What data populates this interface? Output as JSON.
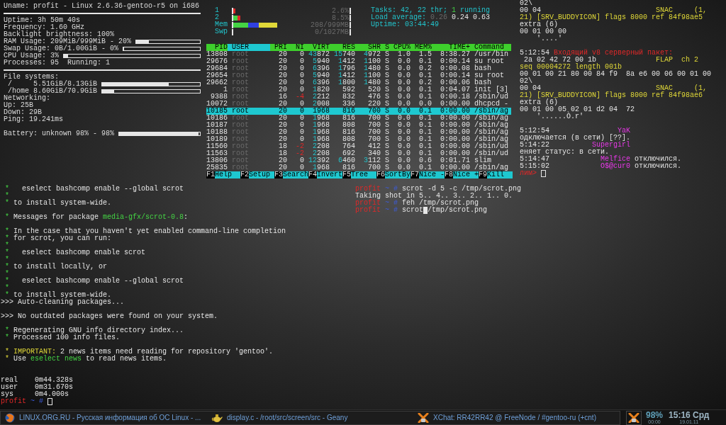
{
  "conky": {
    "items": [
      {
        "kind": "text",
        "text": "Uname: profit - Linux 2.6.36-gentoo-r5 on i686"
      },
      {
        "kind": "rule"
      },
      {
        "kind": "text",
        "text": "Uptime: 3h 50m 40s"
      },
      {
        "kind": "text",
        "text": "Frequency: 1.60 GHz"
      },
      {
        "kind": "text",
        "text": "Backlight brightness: 100%"
      },
      {
        "kind": "bar",
        "text": "RAM Usage: 209MiB/999MiB - 20%",
        "level": 0.2
      },
      {
        "kind": "bar",
        "text": "Swap Usage: 0B/1.00GiB - 0%",
        "level": 0
      },
      {
        "kind": "bar",
        "text": "CPU Usage: 3%",
        "level": 0.03
      },
      {
        "kind": "text",
        "text": "Processes: 95  Running: 1"
      },
      {
        "kind": "rule"
      },
      {
        "kind": "text",
        "text": "File systems:"
      },
      {
        "kind": "bar",
        "text": " /     5.51GiB/8.13GiB",
        "level": 0.68
      },
      {
        "kind": "bar",
        "text": " /home 8.60GiB/70.9GiB",
        "level": 0.12
      },
      {
        "kind": "text",
        "text": "Networking:"
      },
      {
        "kind": "text",
        "text": "Up: 25B"
      },
      {
        "kind": "text",
        "text": "Down: 29B"
      },
      {
        "kind": "text",
        "text": "Ping: 19.241ms"
      },
      {
        "kind": "blank"
      },
      {
        "kind": "bar",
        "text": "Battery: unknown 98% - 98%",
        "level": 0.98
      }
    ]
  },
  "htop": {
    "meters": [
      {
        "label": "1",
        "segments": [
          {
            "kind": "kernel",
            "level": 0.03
          }
        ],
        "value": "2.6%"
      },
      {
        "label": "2",
        "segments": [
          {
            "kind": "user",
            "level": 0.06
          },
          {
            "kind": "kernel",
            "level": 0.09
          }
        ],
        "value": "8.5%"
      },
      {
        "label": "Mem",
        "segments": [
          {
            "kind": "used",
            "level": 0.19
          },
          {
            "kind": "buffers",
            "level": 0.33
          },
          {
            "kind": "cache",
            "level": 0.57
          }
        ],
        "value": "208/999MB"
      },
      {
        "label": "Swp",
        "value": "0/1027MB"
      }
    ],
    "info_lines": [
      [
        {
          "text": "Tasks: 42, 22 thr; ",
          "kind": "label"
        },
        {
          "text": "1",
          "kind": "good"
        },
        {
          "text": " running",
          "kind": "label"
        }
      ],
      [
        {
          "text": "Load average: ",
          "kind": "label"
        },
        {
          "text": "0.26 ",
          "kind": "dim"
        },
        {
          "text": "0.24 0.63",
          "kind": "plain"
        }
      ],
      [
        {
          "text": "Uptime: 03:44:49",
          "kind": "label"
        }
      ]
    ],
    "columns": [
      {
        "label": "PID",
        "selected": false
      },
      {
        "label": "USER",
        "selected": true
      },
      {
        "label": "PRI",
        "selected": false
      },
      {
        "label": "NI",
        "selected": false
      },
      {
        "label": "VIRT",
        "selected": false
      },
      {
        "label": "RES",
        "selected": false
      },
      {
        "label": "SHR",
        "selected": false
      },
      {
        "label": "S",
        "selected": false
      },
      {
        "label": "CPU%",
        "selected": false
      },
      {
        "label": "MEM%",
        "selected": false
      },
      {
        "label": "TIME+",
        "selected": false
      },
      {
        "label": "Command",
        "selected": false
      }
    ],
    "rows": [
      {
        "pid": "13808",
        "user": "root",
        "pri": "20",
        "ni": "0",
        "virt": "43872",
        "res": "15740",
        "shr": "4972",
        "state": "S",
        "cpu": "1.0",
        "mem": "1.5",
        "time": "8:38.27",
        "command": "/usr/bin",
        "selected": false
      },
      {
        "pid": "29676",
        "user": "root",
        "pri": "20",
        "ni": "0",
        "virt": "5940",
        "res": "1412",
        "shr": "1100",
        "state": "S",
        "cpu": "0.0",
        "mem": "0.1",
        "time": "0:00.14",
        "command": "su root",
        "selected": false
      },
      {
        "pid": "29684",
        "user": "root",
        "pri": "20",
        "ni": "0",
        "virt": "6396",
        "res": "1796",
        "shr": "1480",
        "state": "S",
        "cpu": "0.0",
        "mem": "0.2",
        "time": "0:00.08",
        "command": "bash",
        "selected": false
      },
      {
        "pid": "29654",
        "user": "root",
        "pri": "20",
        "ni": "0",
        "virt": "5940",
        "res": "1412",
        "shr": "1100",
        "state": "S",
        "cpu": "0.0",
        "mem": "0.1",
        "time": "0:00.14",
        "command": "su root",
        "selected": false
      },
      {
        "pid": "29662",
        "user": "root",
        "pri": "20",
        "ni": "0",
        "virt": "6396",
        "res": "1800",
        "shr": "1480",
        "state": "S",
        "cpu": "0.0",
        "mem": "0.2",
        "time": "0:00.06",
        "command": "bash",
        "selected": false
      },
      {
        "pid": "1",
        "user": "root",
        "pri": "20",
        "ni": "0",
        "virt": "1820",
        "res": "592",
        "shr": "520",
        "state": "S",
        "cpu": "0.0",
        "mem": "0.1",
        "time": "0:04.07",
        "command": "init [3]",
        "selected": false
      },
      {
        "pid": "9388",
        "user": "root",
        "pri": "16",
        "ni": "-4",
        "virt": "2212",
        "res": "832",
        "shr": "476",
        "state": "S",
        "cpu": "0.0",
        "mem": "0.1",
        "time": "0:00.18",
        "command": "/sbin/ud",
        "selected": false
      },
      {
        "pid": "10072",
        "user": "root",
        "pri": "20",
        "ni": "0",
        "virt": "2008",
        "res": "336",
        "shr": "220",
        "state": "S",
        "cpu": "0.0",
        "mem": "0.0",
        "time": "0:00.00",
        "command": "dhcpcd -",
        "selected": false
      },
      {
        "pid": "10185",
        "user": "root",
        "pri": "20",
        "ni": "0",
        "virt": "1968",
        "res": "816",
        "shr": "700",
        "state": "S",
        "cpu": "0.0",
        "mem": "0.1",
        "time": "0:00.00",
        "command": "/sbin/ag",
        "selected": true
      },
      {
        "pid": "10186",
        "user": "root",
        "pri": "20",
        "ni": "0",
        "virt": "1968",
        "res": "816",
        "shr": "700",
        "state": "S",
        "cpu": "0.0",
        "mem": "0.1",
        "time": "0:00.00",
        "command": "/sbin/ag",
        "selected": false
      },
      {
        "pid": "10187",
        "user": "root",
        "pri": "20",
        "ni": "0",
        "virt": "1968",
        "res": "808",
        "shr": "700",
        "state": "S",
        "cpu": "0.0",
        "mem": "0.1",
        "time": "0:00.00",
        "command": "/sbin/ag",
        "selected": false
      },
      {
        "pid": "10188",
        "user": "root",
        "pri": "20",
        "ni": "0",
        "virt": "1968",
        "res": "816",
        "shr": "700",
        "state": "S",
        "cpu": "0.0",
        "mem": "0.1",
        "time": "0:00.00",
        "command": "/sbin/ag",
        "selected": false
      },
      {
        "pid": "10189",
        "user": "root",
        "pri": "20",
        "ni": "0",
        "virt": "1968",
        "res": "808",
        "shr": "700",
        "state": "S",
        "cpu": "0.0",
        "mem": "0.1",
        "time": "0:00.00",
        "command": "/sbin/ag",
        "selected": false
      },
      {
        "pid": "11560",
        "user": "root",
        "pri": "18",
        "ni": "-2",
        "virt": "2208",
        "res": "764",
        "shr": "412",
        "state": "S",
        "cpu": "0.0",
        "mem": "0.1",
        "time": "0:00.00",
        "command": "/sbin/ud",
        "selected": false
      },
      {
        "pid": "11563",
        "user": "root",
        "pri": "18",
        "ni": "-2",
        "virt": "2208",
        "res": "692",
        "shr": "340",
        "state": "S",
        "cpu": "0.0",
        "mem": "0.1",
        "time": "0:00.00",
        "command": "/sbin/ud",
        "selected": false
      },
      {
        "pid": "13806",
        "user": "root",
        "pri": "20",
        "ni": "0",
        "virt": "12392",
        "res": "6460",
        "shr": "3112",
        "state": "S",
        "cpu": "0.0",
        "mem": "0.6",
        "time": "0:01.71",
        "command": "slim",
        "selected": false
      },
      {
        "pid": "25835",
        "user": "root",
        "pri": "20",
        "ni": "0",
        "virt": "1968",
        "res": "816",
        "shr": "700",
        "state": "S",
        "cpu": "0.0",
        "mem": "0.1",
        "time": "0:00.00",
        "command": "/sbin/ag",
        "selected": false
      }
    ],
    "function_keys": [
      {
        "key": "F1",
        "label": "Help"
      },
      {
        "key": "F2",
        "label": "Setup"
      },
      {
        "key": "F3",
        "label": "Search"
      },
      {
        "key": "F4",
        "label": "Invert"
      },
      {
        "key": "F5",
        "label": "Tree"
      },
      {
        "key": "F6",
        "label": "SortBy"
      },
      {
        "key": "F7",
        "label": "Nice -"
      },
      {
        "key": "F8",
        "label": "Nice +"
      },
      {
        "key": "F9",
        "label": "Kill"
      }
    ]
  },
  "xchat": {
    "lines": [
      {
        "kind": "text",
        "segments": [
          {
            "text": "02\\",
            "kind": "plain"
          }
        ]
      },
      {
        "kind": "text",
        "segments": [
          {
            "text": "00 04",
            "kind": "plain"
          },
          {
            "text": "                           SNAC     (1,",
            "kind": "warning"
          }
        ]
      },
      {
        "kind": "text",
        "segments": [
          {
            "text": "21) [SRV_BUDDYICON] flags 8000 ref 84f98ae5",
            "kind": "warning"
          }
        ]
      },
      {
        "kind": "text",
        "segments": [
          {
            "text": "extra (6)",
            "kind": "plain"
          }
        ]
      },
      {
        "kind": "text",
        "segments": [
          {
            "text": "00 01 00 00",
            "kind": "plain"
          }
        ]
      },
      {
        "kind": "text",
        "segments": [
          {
            "text": "    '....'",
            "kind": "plain"
          }
        ]
      },
      {
        "kind": "blank"
      },
      {
        "kind": "text",
        "segments": [
          {
            "text": "5:12:54 ",
            "kind": "plain"
          },
          {
            "text": "Входящий v8 серверный пакет:",
            "kind": "alert"
          }
        ]
      },
      {
        "kind": "text",
        "segments": [
          {
            "text": " 2a 02 42 72 00 1b",
            "kind": "plain"
          },
          {
            "text": "              FLAP  ch 2",
            "kind": "warning"
          }
        ]
      },
      {
        "kind": "text",
        "segments": [
          {
            "text": "seq 00004272 length 001b",
            "kind": "warning"
          }
        ]
      },
      {
        "kind": "text",
        "segments": [
          {
            "text": "00 01 00 21 80 00 84 f9  8a e6 00 06 00 01 00",
            "kind": "plain"
          }
        ]
      },
      {
        "kind": "text",
        "segments": [
          {
            "text": "02\\",
            "kind": "plain"
          }
        ]
      },
      {
        "kind": "text",
        "segments": [
          {
            "text": "00 04",
            "kind": "plain"
          },
          {
            "text": "                           SNAC     (1,",
            "kind": "warning"
          }
        ]
      },
      {
        "kind": "text",
        "segments": [
          {
            "text": "21) [SRV_BUDDYICON] flags 8000 ref 84f98ae6",
            "kind": "warning"
          }
        ]
      },
      {
        "kind": "text",
        "segments": [
          {
            "text": "extra (6)",
            "kind": "plain"
          }
        ]
      },
      {
        "kind": "text",
        "segments": [
          {
            "text": "00 01 00 05 02 01 d2 04  72",
            "kind": "plain"
          }
        ]
      },
      {
        "kind": "text",
        "segments": [
          {
            "text": "    '......Ò.r'",
            "kind": "plain"
          }
        ]
      },
      {
        "kind": "blank"
      },
      {
        "kind": "text",
        "segments": [
          {
            "text": "5:12:54                ",
            "kind": "plain"
          },
          {
            "text": "YaK",
            "kind": "nick"
          }
        ]
      },
      {
        "kind": "text",
        "segments": [
          {
            "text": "одключается (в сети) [??].",
            "kind": "plain"
          }
        ]
      },
      {
        "kind": "text",
        "segments": [
          {
            "text": "5:14:22          ",
            "kind": "plain"
          },
          {
            "text": "Supergirl",
            "kind": "nick"
          }
        ]
      },
      {
        "kind": "text",
        "segments": [
          {
            "text": "еняет статус: в сети.",
            "kind": "plain"
          }
        ]
      },
      {
        "kind": "text",
        "segments": [
          {
            "text": "5:14:47            ",
            "kind": "plain"
          },
          {
            "text": "Melfice",
            "kind": "nick"
          },
          {
            "text": " отключился.",
            "kind": "plain"
          }
        ]
      },
      {
        "kind": "text",
        "segments": [
          {
            "text": "5:15:02            ",
            "kind": "plain"
          },
          {
            "text": "O$@cur0",
            "kind": "nick"
          },
          {
            "text": " отключился.",
            "kind": "plain"
          }
        ]
      },
      {
        "kind": "text",
        "segments": [
          {
            "text": "лим> ",
            "kind": "alert"
          }
        ],
        "cursor": true,
        "focused": false
      }
    ]
  },
  "emerge_terminal": {
    "lines": [
      {
        "kind": "text",
        "segments": [
          {
            "text": " *",
            "kind": "good"
          },
          {
            "text": "   eselect bashcomp enable --global scrot",
            "kind": "plain"
          }
        ]
      },
      {
        "kind": "text",
        "segments": [
          {
            "text": " *",
            "kind": "good"
          }
        ]
      },
      {
        "kind": "text",
        "segments": [
          {
            "text": " *",
            "kind": "good"
          },
          {
            "text": " to install system-wide.",
            "kind": "plain"
          }
        ]
      },
      {
        "kind": "blank"
      },
      {
        "kind": "text",
        "segments": [
          {
            "text": " *",
            "kind": "good"
          },
          {
            "text": " Messages for package ",
            "kind": "plain"
          },
          {
            "text": "media-gfx/scrot-0.8",
            "kind": "good"
          },
          {
            "text": ":",
            "kind": "plain"
          }
        ]
      },
      {
        "kind": "blank"
      },
      {
        "kind": "text",
        "segments": [
          {
            "text": " *",
            "kind": "good"
          },
          {
            "text": " In the case that you haven't yet enabled command-line completion",
            "kind": "plain"
          }
        ]
      },
      {
        "kind": "text",
        "segments": [
          {
            "text": " *",
            "kind": "good"
          },
          {
            "text": " for scrot, you can run:",
            "kind": "plain"
          }
        ]
      },
      {
        "kind": "text",
        "segments": [
          {
            "text": " *",
            "kind": "good"
          }
        ]
      },
      {
        "kind": "text",
        "segments": [
          {
            "text": " *",
            "kind": "good"
          },
          {
            "text": "   eselect bashcomp enable scrot",
            "kind": "plain"
          }
        ]
      },
      {
        "kind": "text",
        "segments": [
          {
            "text": " *",
            "kind": "good"
          }
        ]
      },
      {
        "kind": "text",
        "segments": [
          {
            "text": " *",
            "kind": "good"
          },
          {
            "text": " to install locally, or",
            "kind": "plain"
          }
        ]
      },
      {
        "kind": "text",
        "segments": [
          {
            "text": " *",
            "kind": "good"
          }
        ]
      },
      {
        "kind": "text",
        "segments": [
          {
            "text": " *",
            "kind": "good"
          },
          {
            "text": "   eselect bashcomp enable --global scrot",
            "kind": "plain"
          }
        ]
      },
      {
        "kind": "text",
        "segments": [
          {
            "text": " *",
            "kind": "good"
          }
        ]
      },
      {
        "kind": "text",
        "segments": [
          {
            "text": " *",
            "kind": "good"
          },
          {
            "text": " to install system-wide.",
            "kind": "plain"
          }
        ]
      },
      {
        "kind": "text",
        "segments": [
          {
            "text": ">>> Auto-cleaning packages...",
            "kind": "plain"
          }
        ]
      },
      {
        "kind": "blank"
      },
      {
        "kind": "text",
        "segments": [
          {
            "text": ">>> No outdated packages were found on your system.",
            "kind": "plain"
          }
        ]
      },
      {
        "kind": "blank"
      },
      {
        "kind": "text",
        "segments": [
          {
            "text": " *",
            "kind": "good"
          },
          {
            "text": " Regenerating GNU info directory index...",
            "kind": "plain"
          }
        ]
      },
      {
        "kind": "text",
        "segments": [
          {
            "text": " *",
            "kind": "good"
          },
          {
            "text": " Processed 100 info files.",
            "kind": "plain"
          }
        ]
      },
      {
        "kind": "blank"
      },
      {
        "kind": "text",
        "segments": [
          {
            "text": " * IMPORTANT:",
            "kind": "warning"
          },
          {
            "text": " 2 news items need reading for repository 'gentoo'.",
            "kind": "plain"
          }
        ]
      },
      {
        "kind": "text",
        "segments": [
          {
            "text": " *",
            "kind": "warning"
          },
          {
            "text": " Use ",
            "kind": "plain"
          },
          {
            "text": "eselect news",
            "kind": "good"
          },
          {
            "text": " to read news items.",
            "kind": "plain"
          }
        ]
      },
      {
        "kind": "blank"
      },
      {
        "kind": "blank"
      },
      {
        "kind": "text",
        "segments": [
          {
            "text": "real    0m44.328s",
            "kind": "plain"
          }
        ]
      },
      {
        "kind": "text",
        "segments": [
          {
            "text": "user    0m31.670s",
            "kind": "plain"
          }
        ]
      },
      {
        "kind": "text",
        "segments": [
          {
            "text": "sys     0m4.000s",
            "kind": "plain"
          }
        ]
      },
      {
        "kind": "text",
        "segments": [
          {
            "text": "profit",
            "kind": "alert"
          },
          {
            "text": " ~ # ",
            "kind": "path"
          }
        ],
        "cursor": true,
        "focused": false
      }
    ]
  },
  "scrot_terminal": {
    "lines": [
      {
        "kind": "text",
        "segments": [
          {
            "text": "profit",
            "kind": "alert"
          },
          {
            "text": " ~ # ",
            "kind": "path"
          },
          {
            "text": "scrot -d 5 -c /tmp/scrot.png",
            "kind": "plain"
          }
        ]
      },
      {
        "kind": "text",
        "segments": [
          {
            "text": "Taking shot in 5.. 4.. 3.. 2.. 1.. 0.",
            "kind": "plain"
          }
        ]
      },
      {
        "kind": "text",
        "segments": [
          {
            "text": "profit",
            "kind": "alert"
          },
          {
            "text": " ~ # ",
            "kind": "path"
          },
          {
            "text": "feh /tmp/scrot.png",
            "kind": "plain"
          }
        ]
      },
      {
        "kind": "text",
        "segments": [
          {
            "text": "profit",
            "kind": "alert"
          },
          {
            "text": " ~ # ",
            "kind": "path"
          },
          {
            "text": "scrot",
            "kind": "plain"
          }
        ],
        "cursor": true,
        "focused": true,
        "rest": [
          {
            "text": "/tmp/scrot.png",
            "kind": "plain"
          }
        ]
      }
    ]
  },
  "taskbar": {
    "tasks": [
      {
        "kind": "browser",
        "title": "LINUX.ORG.RU - Русская информация об ОС Linux - ..."
      },
      {
        "kind": "editor",
        "title": "display.c - /root/src/screen/src - Geany"
      },
      {
        "kind": "chat",
        "title": "XChat: RR42RR42 @ FreeNode / #gentoo-ru (+cnt)"
      }
    ],
    "battery": {
      "percent": "98%",
      "time": "00:00"
    },
    "clock": {
      "time": "15:16 Срд",
      "date": "19.01.11"
    }
  }
}
